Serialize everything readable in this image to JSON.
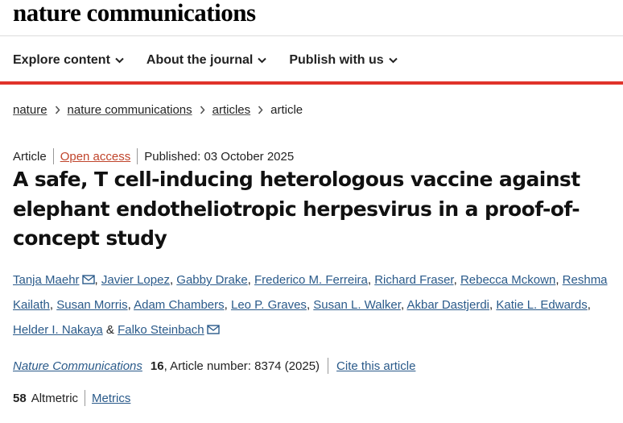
{
  "brand": "nature communications",
  "nav": {
    "items": [
      {
        "label": "Explore content"
      },
      {
        "label": "About the journal"
      },
      {
        "label": "Publish with us"
      }
    ]
  },
  "breadcrumb": {
    "items": [
      "nature",
      "nature communications",
      "articles"
    ],
    "current": "article"
  },
  "article": {
    "type": "Article",
    "access": "Open access",
    "published": "Published: 03 October 2025",
    "title": "A safe, T cell-inducing heterologous vaccine against elephant endotheliotropic herpesvirus in a proof-of-concept study"
  },
  "authors": [
    {
      "name": "Tanja Maehr",
      "email_icon": true
    },
    {
      "name": "Javier Lopez"
    },
    {
      "name": "Gabby Drake"
    },
    {
      "name": "Frederico M. Ferreira"
    },
    {
      "name": "Richard Fraser"
    },
    {
      "name": "Rebecca Mckown"
    },
    {
      "name": "Reshma Kailath"
    },
    {
      "name": "Susan Morris"
    },
    {
      "name": "Adam Chambers"
    },
    {
      "name": "Leo P. Graves"
    },
    {
      "name": "Susan L. Walker"
    },
    {
      "name": "Akbar Dastjerdi"
    },
    {
      "name": "Katie L. Edwards"
    },
    {
      "name": "Helder I. Nakaya"
    },
    {
      "name": "Falko Steinbach",
      "email_icon": true
    }
  ],
  "author_separator": ",",
  "author_last_joiner": "&",
  "citation": {
    "journal": "Nature Communications",
    "volume": "16",
    "article_number": ", Article number: 8374 (2025)",
    "cite_label": "Cite this article"
  },
  "metrics": {
    "altmetric_score": "58",
    "altmetric_label": "Altmetric",
    "metrics_link": "Metrics"
  },
  "colors": {
    "accent_red": "#e0332b",
    "link_blue": "#2a5a8a",
    "open_access": "#c0442b"
  }
}
